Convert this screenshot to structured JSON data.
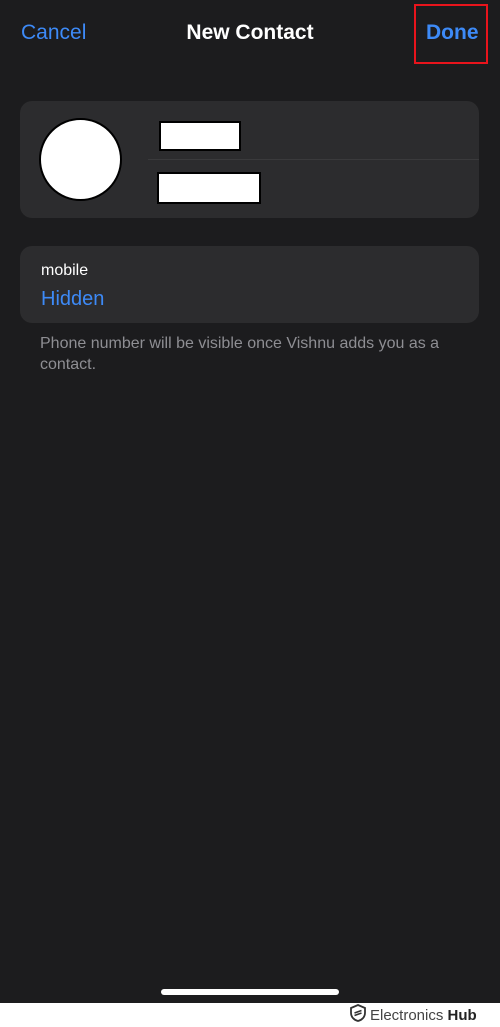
{
  "nav": {
    "cancel_label": "Cancel",
    "title": "New Contact",
    "done_label": "Done"
  },
  "phone": {
    "label": "mobile",
    "value": "Hidden"
  },
  "footnote": "Phone number will be visible once Vishnu adds you as a contact.",
  "watermark": {
    "brand_light": "Electronics",
    "brand_bold": "Hub",
    "icon": "shield-logo-icon"
  },
  "colors": {
    "background": "#1c1c1e",
    "card": "#2c2c2e",
    "accent": "#3d8af7",
    "highlight": "#e8141c",
    "secondary_text": "#8e8e93"
  }
}
